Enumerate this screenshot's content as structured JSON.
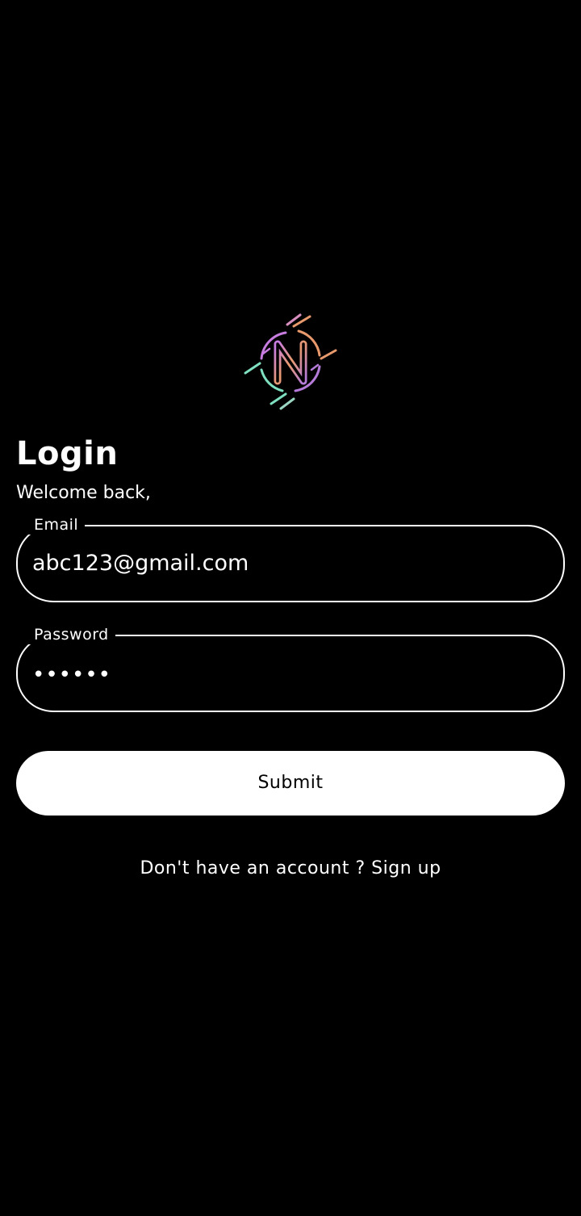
{
  "logo": {
    "icon": "n-letter-logo-icon",
    "colors": [
      "#c77ce0",
      "#e89a6d",
      "#7fe0c1",
      "#b57bd8"
    ]
  },
  "login": {
    "title": "Login",
    "subtitle": "Welcome back,"
  },
  "email": {
    "label": "Email",
    "value": "abc123@gmail.com"
  },
  "password": {
    "label": "Password",
    "value": "••••••"
  },
  "submit": {
    "label": "Submit"
  },
  "signup": {
    "prompt": "Don't have an account ?",
    "link": "Sign up"
  }
}
